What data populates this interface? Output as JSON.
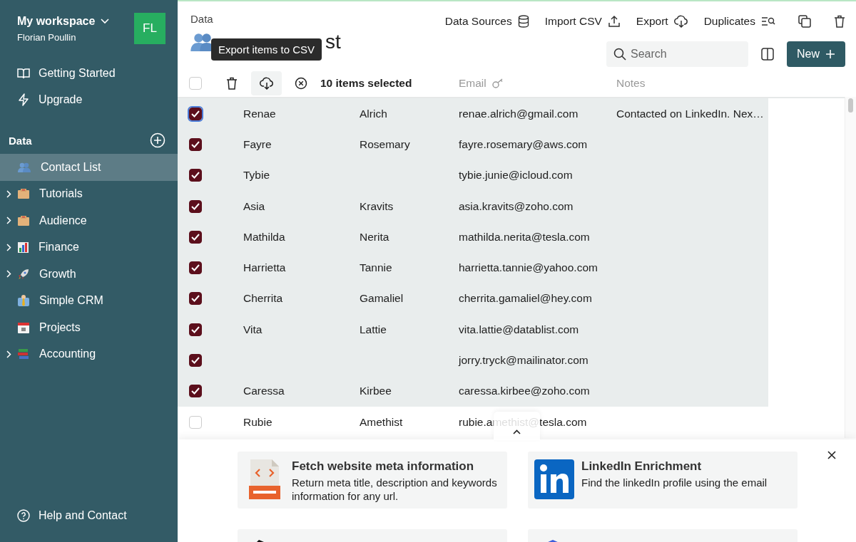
{
  "sidebar": {
    "workspace": "My workspace",
    "user": "Florian Poullin",
    "avatar": "FL",
    "nav": [
      "Getting Started",
      "Upgrade"
    ],
    "section": "Data",
    "items": [
      {
        "label": "Contact List",
        "selected": true,
        "expandable": false
      },
      {
        "label": "Tutorials",
        "selected": false,
        "expandable": true
      },
      {
        "label": "Audience",
        "selected": false,
        "expandable": true
      },
      {
        "label": "Finance",
        "selected": false,
        "expandable": true
      },
      {
        "label": "Growth",
        "selected": false,
        "expandable": true
      },
      {
        "label": "Simple CRM",
        "selected": false,
        "expandable": false
      },
      {
        "label": "Projects",
        "selected": false,
        "expandable": false
      },
      {
        "label": "Accounting",
        "selected": false,
        "expandable": true
      }
    ],
    "help": "Help and Contact"
  },
  "header": {
    "breadcrumb": "Data",
    "title": "st",
    "toolbar": [
      "Data Sources",
      "Import CSV",
      "Export",
      "Duplicates"
    ],
    "search": {
      "placeholder": "Search"
    },
    "new_button": "New"
  },
  "tooltip": "Export items to CSV",
  "selection": {
    "checked": false,
    "count_label": "10 items selected"
  },
  "table": {
    "columns": [
      "Email",
      "Notes"
    ],
    "rows": [
      {
        "first": "Renae",
        "last": "Alrich",
        "email": "renae.alrich@gmail.com",
        "notes": "Contacted on LinkedIn. Nex…",
        "selected": true,
        "focused": true
      },
      {
        "first": "Fayre",
        "last": "Rosemary",
        "email": "fayre.rosemary@aws.com",
        "selected": true,
        "focused": false
      },
      {
        "first": "Tybie",
        "email": "tybie.junie@icloud.com",
        "selected": true,
        "focused": false
      },
      {
        "first": "Asia",
        "last": "Kravits",
        "email": "asia.kravits@zoho.com",
        "selected": true,
        "focused": false
      },
      {
        "first": "Mathilda",
        "last": "Nerita",
        "email": "mathilda.nerita@tesla.com",
        "selected": true,
        "focused": false
      },
      {
        "first": "Harrietta",
        "last": "Tannie",
        "email": "harrietta.tannie@yahoo.com",
        "selected": true,
        "focused": false
      },
      {
        "first": "Cherrita",
        "last": "Gamaliel",
        "email": "cherrita.gamaliel@hey.com",
        "selected": true,
        "focused": false
      },
      {
        "first": "Vita",
        "last": "Lattie",
        "email": "vita.lattie@datablist.com",
        "selected": true,
        "focused": false
      },
      {
        "email": "jorry.tryck@mailinator.com",
        "selected": true,
        "focused": false
      },
      {
        "first": "Caressa",
        "last": "Kirbee",
        "email": "caressa.kirbee@zoho.com",
        "selected": true,
        "focused": false
      },
      {
        "first": "Rubie",
        "last": "Amethist",
        "email": "rubie.amethist@tesla.com",
        "selected": false,
        "focused": false
      }
    ]
  },
  "enrichments": [
    {
      "kind": "html",
      "title": "Fetch website meta information",
      "description": "Return meta title, description and keywords information for any url."
    },
    {
      "kind": "linkedin",
      "title": "LinkedIn Enrichment",
      "description": "Find the linkedIn profile using the email"
    },
    {
      "kind": "echo"
    },
    {
      "kind": "email"
    }
  ]
}
